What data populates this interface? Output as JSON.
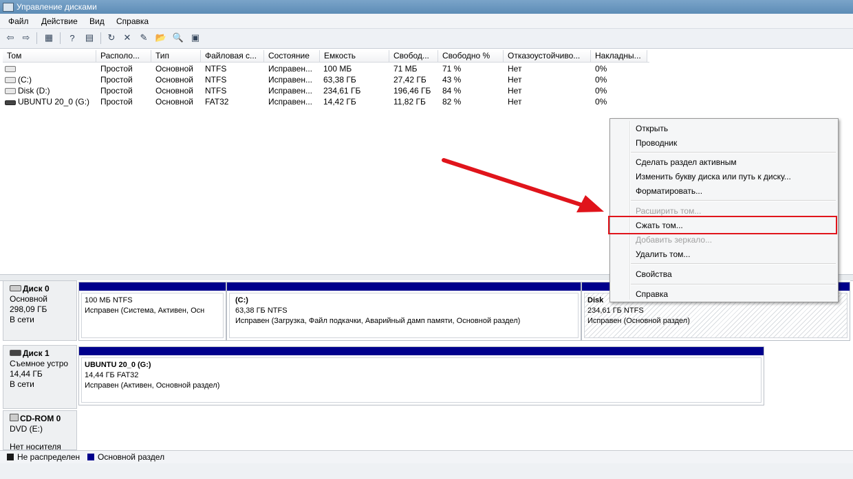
{
  "window": {
    "title": "Управление дисками"
  },
  "menu": [
    "Файл",
    "Действие",
    "Вид",
    "Справка"
  ],
  "toolbar": {
    "icons": [
      "back-arrow-icon",
      "forward-arrow-icon",
      "view-top-icon",
      "help-icon",
      "view-bottom-icon",
      "refresh-icon",
      "delete-icon",
      "properties-icon",
      "open-folder-icon",
      "explore-icon",
      "settings-icon"
    ],
    "glyphs": [
      "⇦",
      "⇨",
      "▦",
      "?",
      "▤",
      "↻",
      "✕",
      "✎",
      "📂",
      "🔍",
      "▣"
    ]
  },
  "columns": [
    "Том",
    "Располо...",
    "Тип",
    "Файловая с...",
    "Состояние",
    "Емкость",
    "Свобод...",
    "Свободно %",
    "Отказоустойчиво...",
    "Накладны..."
  ],
  "volumes": [
    {
      "name": "",
      "layout": "Простой",
      "type": "Основной",
      "fs": "NTFS",
      "status": "Исправен...",
      "capacity": "100 МБ",
      "free": "71 МБ",
      "free_pct": "71 %",
      "fault": "Нет",
      "overhead": "0%"
    },
    {
      "name": "(C:)",
      "layout": "Простой",
      "type": "Основной",
      "fs": "NTFS",
      "status": "Исправен...",
      "capacity": "63,38 ГБ",
      "free": "27,42 ГБ",
      "free_pct": "43 %",
      "fault": "Нет",
      "overhead": "0%"
    },
    {
      "name": "Disk (D:)",
      "layout": "Простой",
      "type": "Основной",
      "fs": "NTFS",
      "status": "Исправен...",
      "capacity": "234,61 ГБ",
      "free": "196,46 ГБ",
      "free_pct": "84 %",
      "fault": "Нет",
      "overhead": "0%"
    },
    {
      "name": "UBUNTU 20_0 (G:)",
      "layout": "Простой",
      "type": "Основной",
      "fs": "FAT32",
      "status": "Исправен...",
      "capacity": "14,42 ГБ",
      "free": "11,82 ГБ",
      "free_pct": "82 %",
      "fault": "Нет",
      "overhead": "0%"
    }
  ],
  "disks": [
    {
      "title": "Диск 0",
      "kind": "Основной",
      "size": "298,09 ГБ",
      "state": "В сети",
      "partitions": [
        {
          "name": "",
          "line1": "100 МБ NTFS",
          "line2": "Исправен (Система, Активен, Осн"
        },
        {
          "name": "(C:)",
          "line1": "63,38 ГБ NTFS",
          "line2": "Исправен (Загрузка, Файл подкачки, Аварийный дамп памяти, Основной раздел)"
        },
        {
          "name": "Disk",
          "line1": "234,61 ГБ NTFS",
          "line2": "Исправен (Основной раздел)"
        }
      ]
    },
    {
      "title": "Диск 1",
      "kind": "Съемное устро",
      "size": "14,44 ГБ",
      "state": "В сети",
      "partitions": [
        {
          "name": "UBUNTU 20_0  (G:)",
          "line1": "14,44 ГБ FAT32",
          "line2": "Исправен (Активен, Основной раздел)"
        }
      ]
    },
    {
      "title": "CD-ROM 0",
      "kind": "DVD (E:)",
      "state": "Нет носителя"
    }
  ],
  "legend": [
    {
      "label": "Не распределен",
      "color": "#1a1a1a"
    },
    {
      "label": "Основной раздел",
      "color": "#00008c"
    }
  ],
  "context_menu": {
    "items": [
      {
        "label": "Открыть",
        "enabled": true
      },
      {
        "label": "Проводник",
        "enabled": true
      },
      {
        "label": "Сделать раздел активным",
        "enabled": true
      },
      {
        "label": "Изменить букву диска или путь к диску...",
        "enabled": true
      },
      {
        "label": "Форматировать...",
        "enabled": true
      },
      {
        "label": "Расширить том...",
        "enabled": false
      },
      {
        "label": "Сжать том...",
        "enabled": true,
        "highlighted": true
      },
      {
        "label": "Добавить зеркало...",
        "enabled": false
      },
      {
        "label": "Удалить том...",
        "enabled": true
      },
      {
        "label": "Свойства",
        "enabled": true
      },
      {
        "label": "Справка",
        "enabled": true
      }
    ]
  },
  "colors": {
    "partition_bar": "#00008c",
    "annotation": "#e0141b"
  }
}
